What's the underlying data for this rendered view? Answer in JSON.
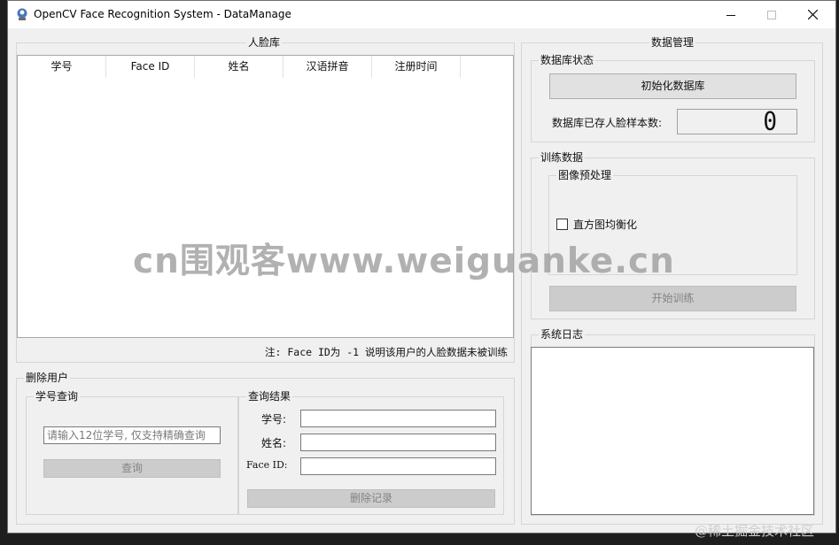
{
  "window": {
    "title": "OpenCV Face Recognition System - DataManage",
    "min_icon": "minimize-icon",
    "max_icon": "maximize-icon",
    "close_icon": "close-icon"
  },
  "face_db": {
    "title": "人脸库",
    "columns": [
      "学号",
      "Face ID",
      "姓名",
      "汉语拼音",
      "注册时间"
    ],
    "note": "注: Face ID为 -1 说明该用户的人脸数据未被训练"
  },
  "delete_user": {
    "title": "删除用户",
    "query": {
      "title": "学号查询",
      "placeholder": "请输入12位学号, 仅支持精确查询",
      "button": "查询"
    },
    "result": {
      "title": "查询结果",
      "fields": [
        {
          "label": "学号:",
          "value": ""
        },
        {
          "label": "姓名:",
          "value": ""
        },
        {
          "label": "Face ID:",
          "value": ""
        }
      ],
      "button": "删除记录"
    }
  },
  "data_mgmt": {
    "title": "数据管理",
    "status": {
      "title": "数据库状态",
      "init_button": "初始化数据库",
      "count_label": "数据库已存人脸样本数:",
      "count_value": "0"
    },
    "training": {
      "title": "训练数据",
      "preprocess": {
        "title": "图像预处理",
        "checkbox_label": "直方图均衡化",
        "checked": false
      },
      "button": "开始训练"
    },
    "log": {
      "title": "系统日志",
      "content": ""
    }
  },
  "overlay": {
    "watermark": "cn围观客www.weiguanke.cn",
    "credit": "@稀土掘金技术社区"
  }
}
